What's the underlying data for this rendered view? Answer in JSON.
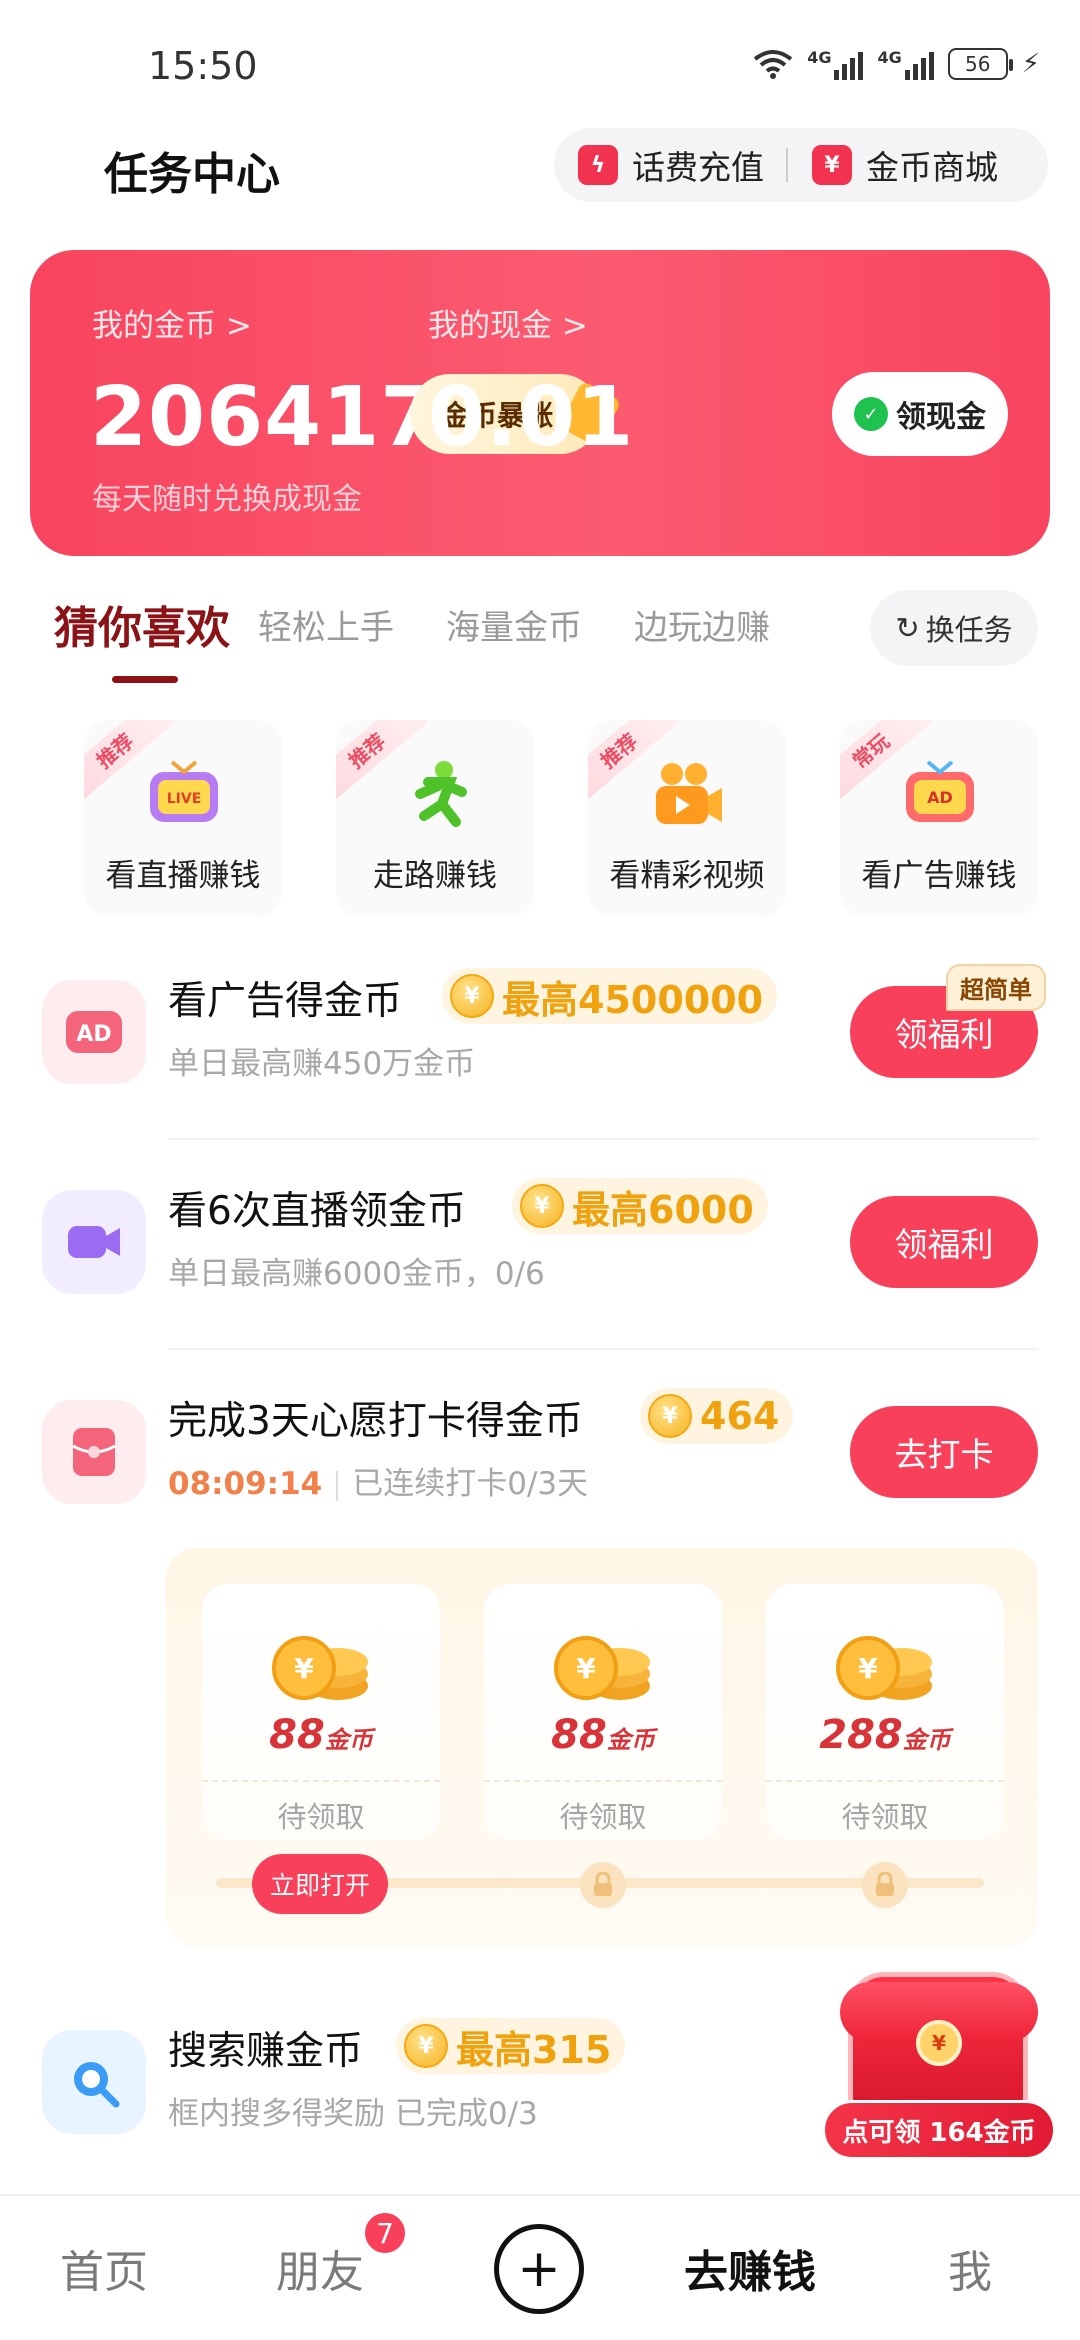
{
  "status_bar": {
    "time": "15:50",
    "network_label": "4G",
    "battery": "56"
  },
  "header": {
    "title": "任务中心",
    "phone_recharge": "话费充值",
    "coin_store": "金币商城"
  },
  "wallet": {
    "coins_label": "我的金币 >",
    "coins_value": "206417",
    "coins_sub": "每天随时兑换成现金",
    "surge_button": "金币暴涨",
    "cash_label": "我的现金 >",
    "cash_value": "0.01",
    "withdraw_button": "领现金"
  },
  "tabs": {
    "items": [
      "猜你喜欢",
      "轻松上手",
      "海量金币",
      "边玩边赚"
    ],
    "refresh": "换任务"
  },
  "categories": [
    {
      "tag": "推荐",
      "label": "看直播赚钱",
      "icon": "live-tv-icon"
    },
    {
      "tag": "推荐",
      "label": "走路赚钱",
      "icon": "walking-icon"
    },
    {
      "tag": "推荐",
      "label": "看精彩视频",
      "icon": "video-camera-icon"
    },
    {
      "tag": "常玩",
      "label": "看广告赚钱",
      "icon": "ad-tv-icon"
    }
  ],
  "tasks": [
    {
      "title": "看广告得金币",
      "reward": "最高4500000",
      "sub": "单日最高赚450万金币",
      "button": "领福利",
      "badge": "超简单",
      "icon": "ad-icon"
    },
    {
      "title": "看6次直播领金币",
      "reward": "最高6000",
      "sub": "单日最高赚6000金币，0/6",
      "button": "领福利",
      "icon": "video-icon"
    },
    {
      "title": "完成3天心愿打卡得金币",
      "reward": "464",
      "timer": "08:09:14",
      "sub": "已连续打卡0/3天",
      "button": "去打卡",
      "icon": "red-envelope-icon"
    },
    {
      "title": "搜索赚金币",
      "reward": "最高315",
      "sub": "框内搜多得奖励 已完成0/3",
      "icon": "search-icon"
    }
  ],
  "checkin": {
    "days": [
      {
        "amount": "88",
        "unit": "金币",
        "status": "待领取"
      },
      {
        "amount": "88",
        "unit": "金币",
        "status": "待领取"
      },
      {
        "amount": "288",
        "unit": "金币",
        "status": "待领取"
      }
    ],
    "open_now": "立即打开"
  },
  "coin_symbol": "¥",
  "chest": {
    "label": "点可领 164金币"
  },
  "bottom_nav": {
    "home": "首页",
    "friends": "朋友",
    "friends_badge": "7",
    "earn": "去赚钱",
    "me": "我"
  },
  "colors": {
    "primary": "#f8405b",
    "gold": "#f0a20e",
    "tab_active": "#8b1215"
  }
}
